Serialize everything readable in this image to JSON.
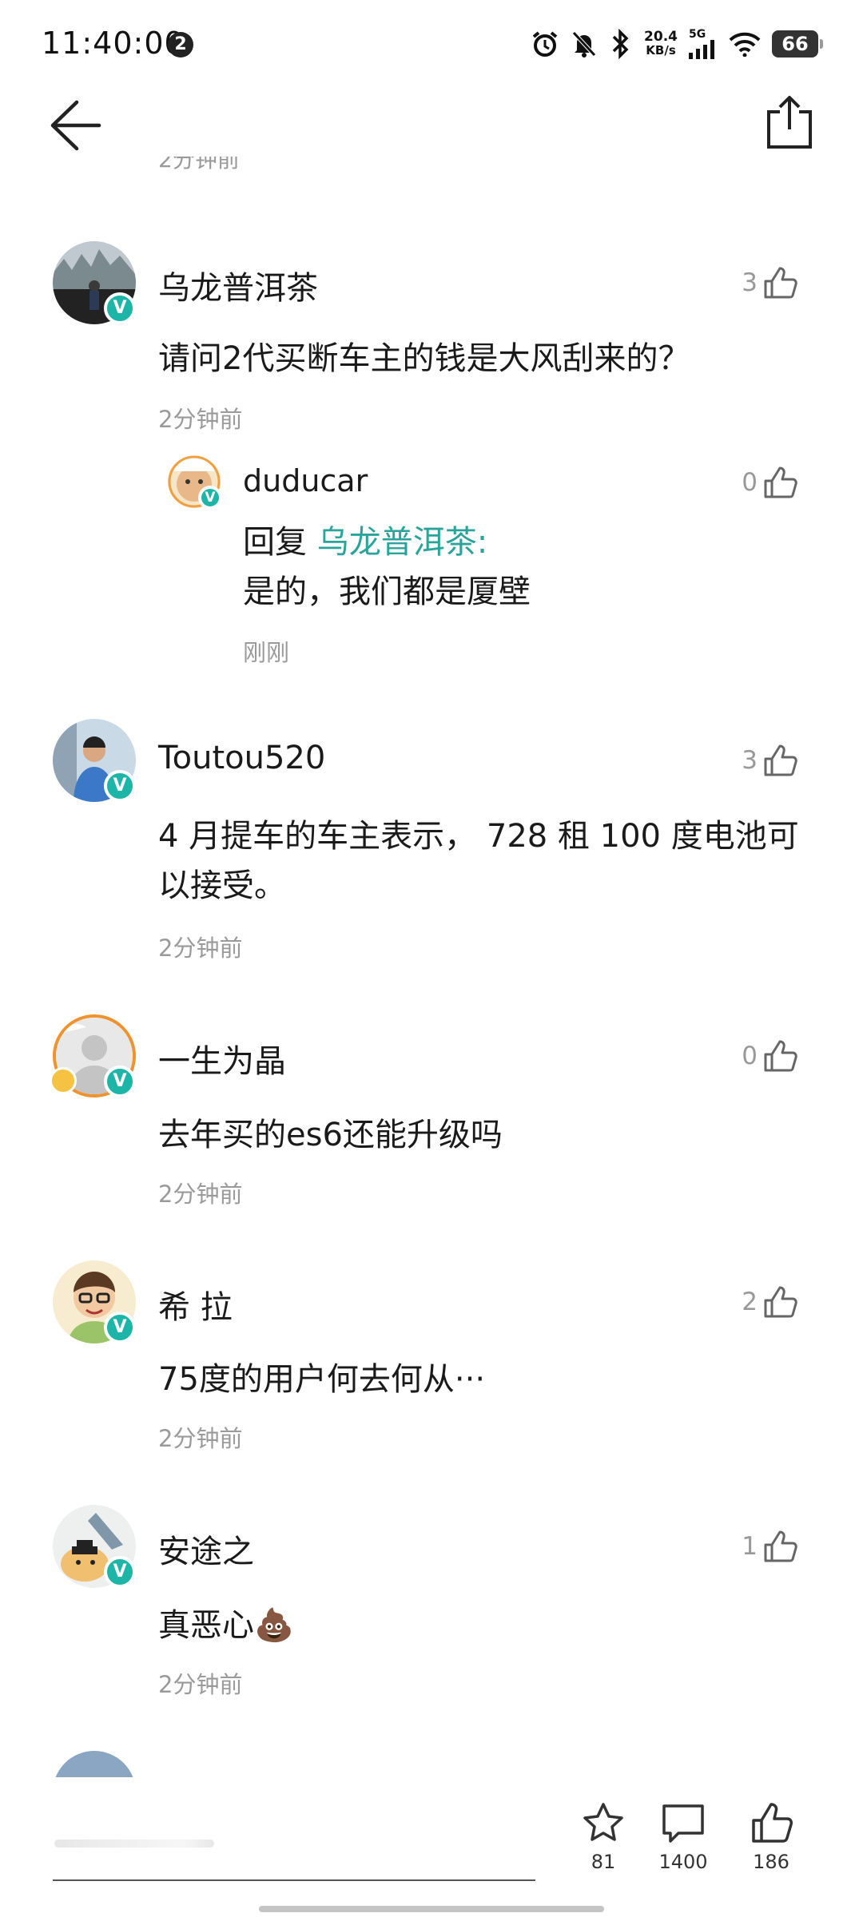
{
  "status_bar": {
    "time": "11:40:00",
    "notification_count": "2",
    "net_speed_value": "20.4",
    "net_speed_unit": "KB/s",
    "signal_label": "5G",
    "battery": "66"
  },
  "cut_off_time": "2分钟前",
  "comments": [
    {
      "username": "乌龙普洱茶",
      "text": "请问2代买断车主的钱是大风刮来的？",
      "time": "2分钟前",
      "likes": "3",
      "reply": {
        "username": "duducar",
        "reply_prefix": "回复",
        "reply_target": "乌龙普洱茶:",
        "text": "是的，我们都是厦壁",
        "time": "刚刚",
        "likes": "0"
      }
    },
    {
      "username": "Toutou520",
      "text": "4 月提车的车主表示， 728 租 100 度电池可以接受。",
      "time": "2分钟前",
      "likes": "3"
    },
    {
      "username": "一生为晶",
      "text": "去年买的es6还能升级吗",
      "time": "2分钟前",
      "likes": "0"
    },
    {
      "username": "希 拉",
      "text": "75度的用户何去何从···",
      "time": "2分钟前",
      "likes": "2"
    },
    {
      "username": "安途之",
      "text": "真恶心💩",
      "time": "2分钟前",
      "likes": "1"
    }
  ],
  "bottom_bar": {
    "favorites": "81",
    "comments": "1400",
    "likes": "186"
  },
  "icons": {
    "verified_badge": "V",
    "accent_color": "#1db5a7",
    "reply_link_color": "#2aa39a"
  }
}
